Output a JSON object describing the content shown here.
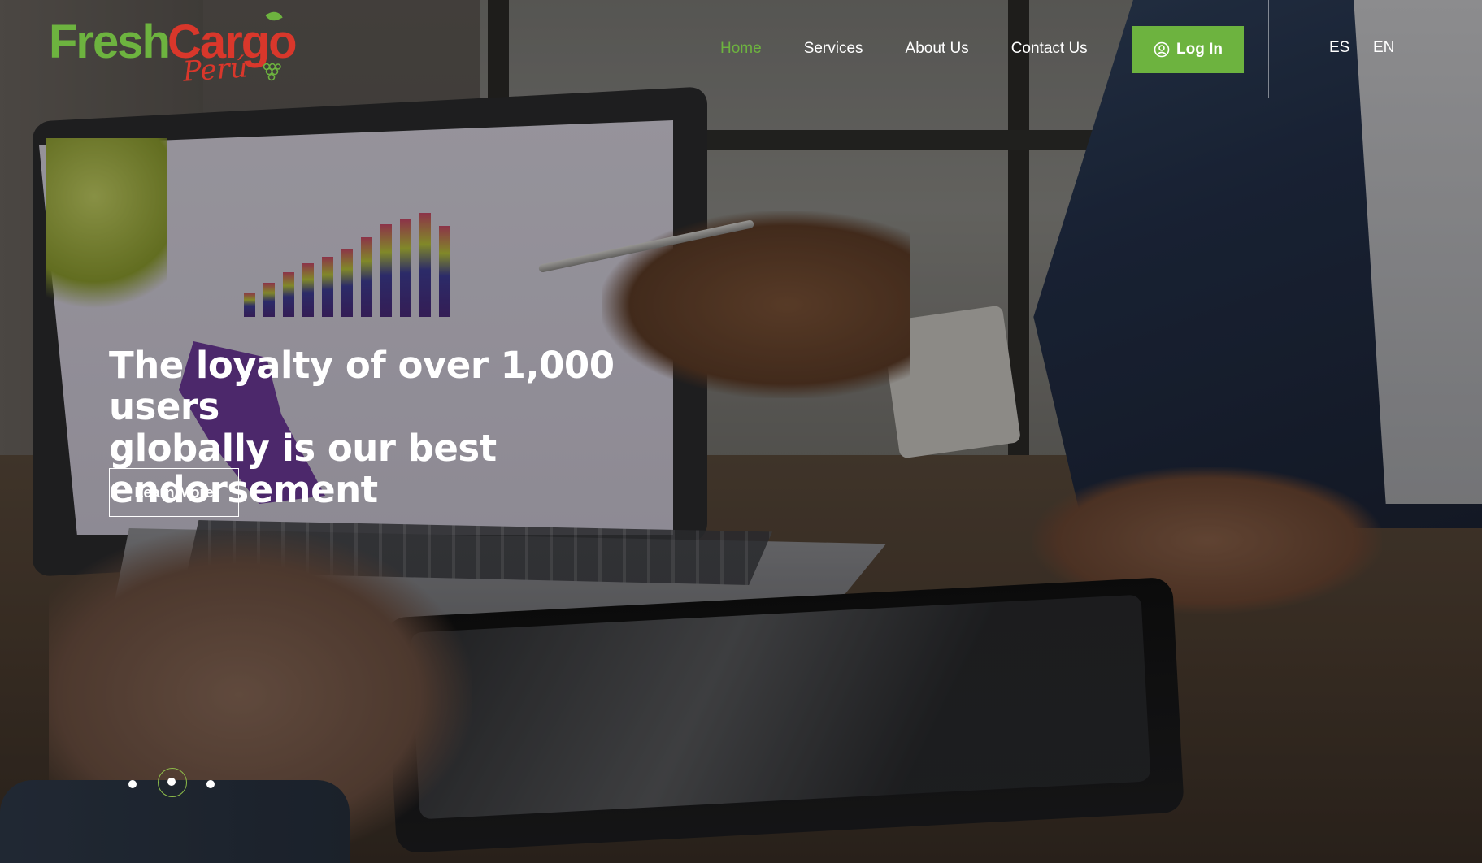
{
  "brand": {
    "logo_fresh": "Fresh",
    "logo_cargo": "Cargo",
    "logo_peru": "Perú",
    "colors": {
      "green": "#6db33f",
      "red": "#d9372b"
    }
  },
  "nav": {
    "items": [
      {
        "label": "Home",
        "active": true
      },
      {
        "label": "Services",
        "active": false
      },
      {
        "label": "About Us",
        "active": false
      },
      {
        "label": "Contact Us",
        "active": false
      }
    ],
    "login_label": "Log In",
    "login_icon": "user-circle-icon",
    "languages": [
      "ES",
      "EN"
    ]
  },
  "hero": {
    "title_line1": "The loyalty of over 1,000 users",
    "title_line2": "globally is our best endorsement",
    "cta_label": "Learn More",
    "slider": {
      "count": 3,
      "active_index": 2
    }
  }
}
